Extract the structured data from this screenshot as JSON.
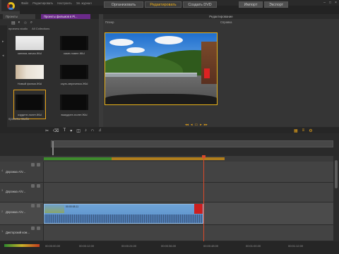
{
  "menubar": {
    "items": [
      "Файл",
      "Редактировать",
      "Настроить",
      "Эл. журнал"
    ]
  },
  "modes": [
    {
      "label": "Организовать"
    },
    {
      "label": "Редактировать"
    },
    {
      "label": "Создать DVD"
    }
  ],
  "toprightbuttons": [
    "Импорт",
    "Экспорт"
  ],
  "library": {
    "tabs": [
      "Проекты",
      "Проекты фильмов в Pi..."
    ],
    "header": [
      "проекты studio",
      "All Collections"
    ],
    "tiles": [
      {
        "caption": "кинема-ничая.ЖЫ"
      },
      {
        "caption": "камн-новее.ЖЫ"
      },
      {
        "caption": "Новый фильм.ЖЫ"
      },
      {
        "caption": "озуть-верхчевоо.ЖЫ"
      },
      {
        "caption": "озудите-полет.ЖЫ"
      },
      {
        "caption": "выкудите-полет.ЖЫ"
      }
    ],
    "footer": "проекты studio"
  },
  "player": {
    "title": "Редактирование",
    "left_label": "Плеер",
    "right_label": "Справка"
  },
  "timeline": {
    "tracks": [
      {
        "name": "Дорожка A/V..."
      },
      {
        "name": "Дорожка A/V..."
      },
      {
        "name": "Дорожка A/V..."
      },
      {
        "name": "Дикторский ком..."
      }
    ],
    "clip_label": "00:00:08.11",
    "scale": [
      "00:00:00.00",
      "00:00:12.00",
      "00:00:24.00",
      "00:00:36.00",
      "00:00:48.00",
      "00:01:00.00",
      "00:01:12.00",
      "00:01:24.00",
      "00:01:36.00",
      "00:01:48.00"
    ]
  }
}
